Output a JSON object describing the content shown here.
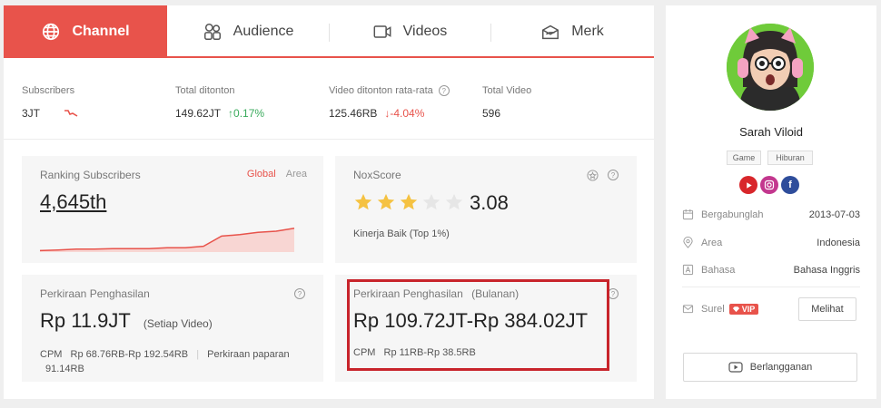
{
  "tabs": [
    {
      "label": "Channel",
      "icon": "globe-icon",
      "active": true
    },
    {
      "label": "Audience",
      "icon": "audience-icon",
      "active": false
    },
    {
      "label": "Videos",
      "icon": "video-camera-icon",
      "active": false
    },
    {
      "label": "Merk",
      "icon": "brand-box-icon",
      "active": false
    }
  ],
  "stats": [
    {
      "label": "Subscribers",
      "value": "3JT",
      "change": ""
    },
    {
      "label": "Total ditonton",
      "value": "149.62JT",
      "change": "0.17%"
    },
    {
      "label": "Video ditonton rata-rata",
      "value": "125.46RB",
      "change": "-4.04%"
    },
    {
      "label": "Total Video",
      "value": "596",
      "change": ""
    }
  ],
  "ranking": {
    "title": "Ranking Subscribers",
    "value": "4,645th",
    "filter_global": "Global",
    "filter_area": "Area",
    "trend": [
      0.05,
      0.07,
      0.1,
      0.1,
      0.12,
      0.12,
      0.12,
      0.15,
      0.15,
      0.2,
      0.55,
      0.6,
      0.68,
      0.72,
      0.82
    ]
  },
  "noxscore": {
    "title": "NoxScore",
    "score": "3.08",
    "stars_filled": 3,
    "stars_total": 5,
    "subtitle": "Kinerja Baik (Top 1%)"
  },
  "earnings_video": {
    "title": "Perkiraan Penghasilan",
    "value": "Rp 11.9JT",
    "unit": "(Setiap Video)",
    "cpm_label": "CPM",
    "cpm_value": "Rp 68.76RB-Rp 192.54RB",
    "exposure_label": "Perkiraan paparan",
    "exposure_value": "91.14RB"
  },
  "earnings_month": {
    "title": "Perkiraan Penghasilan",
    "unit": "(Bulanan)",
    "value": "Rp 109.72JT-Rp 384.02JT",
    "cpm_label": "CPM",
    "cpm_value": "Rp 11RB-Rp 38.5RB"
  },
  "profile": {
    "name": "Sarah Viloid",
    "tags": [
      "Game",
      "Hiburan"
    ],
    "socials": [
      {
        "icon": "youtube-icon",
        "color": "#d8262b"
      },
      {
        "icon": "instagram-icon",
        "color": "#c3378e"
      },
      {
        "icon": "facebook-icon",
        "color": "#2e4d9b"
      }
    ],
    "info": [
      {
        "label": "Bergabunglah",
        "value": "2013-07-03",
        "icon": "calendar-icon"
      },
      {
        "label": "Area",
        "value": "Indonesia",
        "icon": "location-pin-icon"
      },
      {
        "label": "Bahasa",
        "value": "Bahasa Inggris",
        "icon": "language-icon"
      }
    ],
    "email_label": "Surel",
    "vip_label": "VIP",
    "view_button": "Melihat",
    "subscribe_button": "Berlangganan"
  },
  "colors": {
    "accent": "#e8534b",
    "up": "#3aaa5c",
    "star": "#f5c242",
    "highlight_box": "#c8242b"
  }
}
